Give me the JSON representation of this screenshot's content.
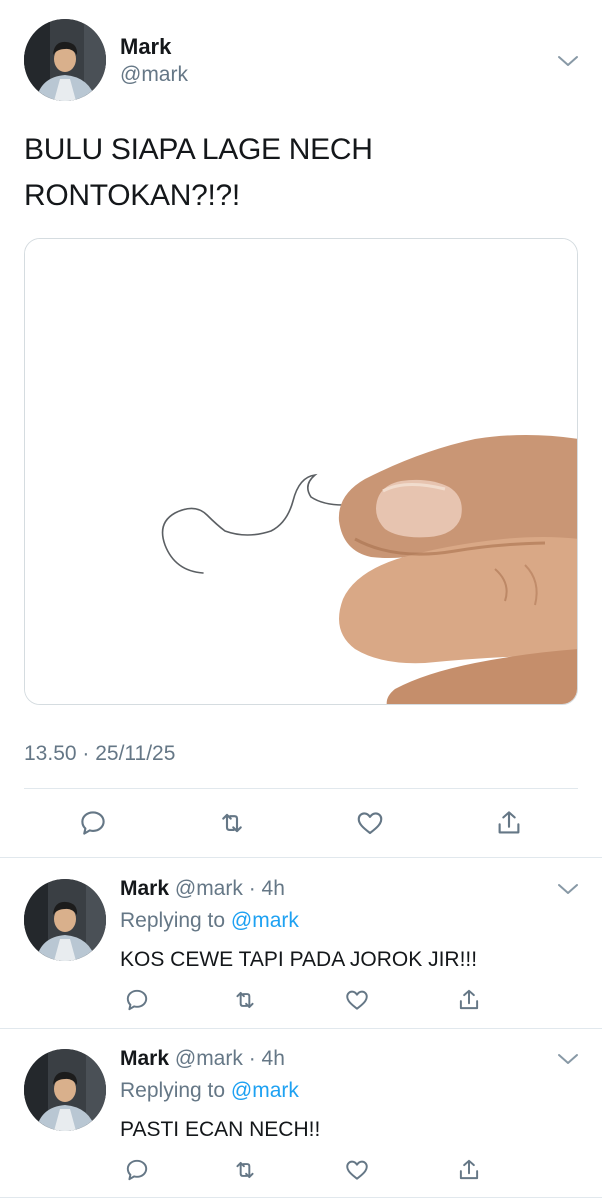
{
  "main_tweet": {
    "author_name": "Mark",
    "author_handle": "@mark",
    "text_line1": "BULU SIAPA LAGE NECH",
    "text_line2": "RONTOKAN?!?!",
    "timestamp": "13.50 · 25/11/25",
    "media_description": "hand-holding-hair-photo"
  },
  "actions": {
    "reply_icon": "reply-icon",
    "retweet_icon": "retweet-icon",
    "like_icon": "heart-icon",
    "share_icon": "share-icon"
  },
  "replies": [
    {
      "author_name": "Mark",
      "author_handle": "@mark",
      "time": "4h",
      "replying_label": "Replying to",
      "replying_to": "@mark",
      "text": "KOS CEWE TAPI PADA JOROK JIR!!!"
    },
    {
      "author_name": "Mark",
      "author_handle": "@mark",
      "time": "4h",
      "replying_label": "Replying to",
      "replying_to": "@mark",
      "text": "PASTI ECAN NECH!!"
    }
  ],
  "colors": {
    "text_primary": "#14171a",
    "text_secondary": "#657786",
    "link": "#1da1f2",
    "divider": "#e1e8ed"
  }
}
